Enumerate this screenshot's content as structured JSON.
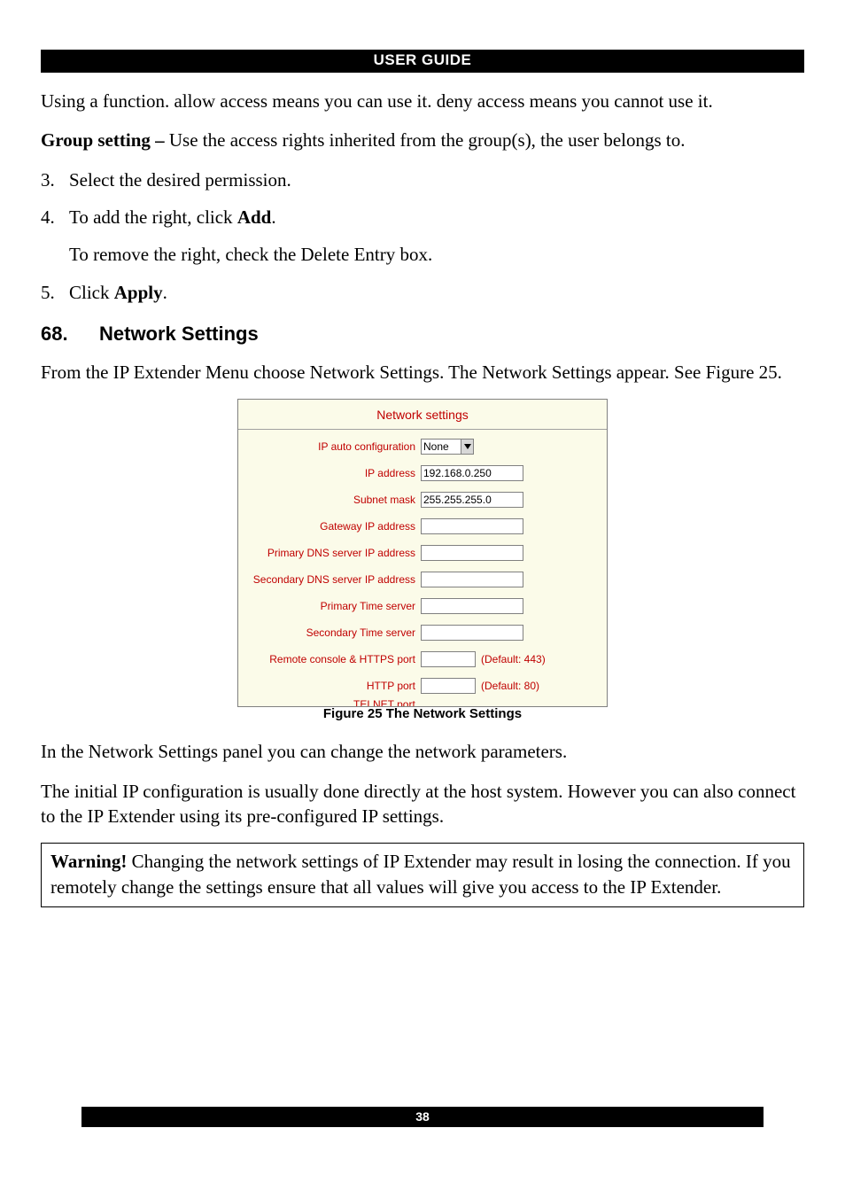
{
  "header": "USER GUIDE",
  "intro": "Using a function. allow access means you can use it. deny access means you cannot use it.",
  "group_setting_label": "Group setting – ",
  "group_setting_text": "Use the access rights inherited from the group(s), the user belongs to.",
  "steps": {
    "s3": {
      "num": "3.",
      "text": "Select the desired permission."
    },
    "s4": {
      "num": "4.",
      "text_a": "To add the right, click ",
      "bold": "Add",
      "text_b": ".",
      "sub": "To remove the right, check the Delete Entry box."
    },
    "s5": {
      "num": "5.",
      "text_a": "Click ",
      "bold": "Apply",
      "text_b": "."
    }
  },
  "section": {
    "num": "68.",
    "title": "Network Settings"
  },
  "section_intro": "From the IP Extender Menu choose Network Settings. The Network Settings appear. See Figure 25.",
  "panel": {
    "title": "Network settings",
    "rows": {
      "ip_auto": {
        "label": "IP auto configuration",
        "value": "None"
      },
      "ip_addr": {
        "label": "IP address",
        "value": "192.168.0.250"
      },
      "subnet": {
        "label": "Subnet mask",
        "value": "255.255.255.0"
      },
      "gateway": {
        "label": "Gateway IP address",
        "value": ""
      },
      "pdns": {
        "label": "Primary DNS server IP address",
        "value": ""
      },
      "sdns": {
        "label": "Secondary DNS server IP address",
        "value": ""
      },
      "ptime": {
        "label": "Primary Time server",
        "value": ""
      },
      "stime": {
        "label": "Secondary Time server",
        "value": ""
      },
      "https": {
        "label": "Remote console & HTTPS port",
        "value": "",
        "hint": "(Default: 443)"
      },
      "http": {
        "label": "HTTP port",
        "value": "",
        "hint": "(Default: 80)"
      },
      "telnet_cut": "TELNET port"
    }
  },
  "figure_caption": "Figure 25 The Network Settings",
  "para_after_fig_1": "In the Network Settings panel you can change the network parameters.",
  "para_after_fig_2": "The initial IP configuration is usually done directly at the host system. However you can also connect to the IP Extender using its pre-configured IP settings.",
  "warning_label": "Warning! ",
  "warning_text": "Changing the network settings of IP Extender may result in losing the connection. If you remotely change the settings ensure that all values will give you access to the IP Extender.",
  "page_number": "38"
}
